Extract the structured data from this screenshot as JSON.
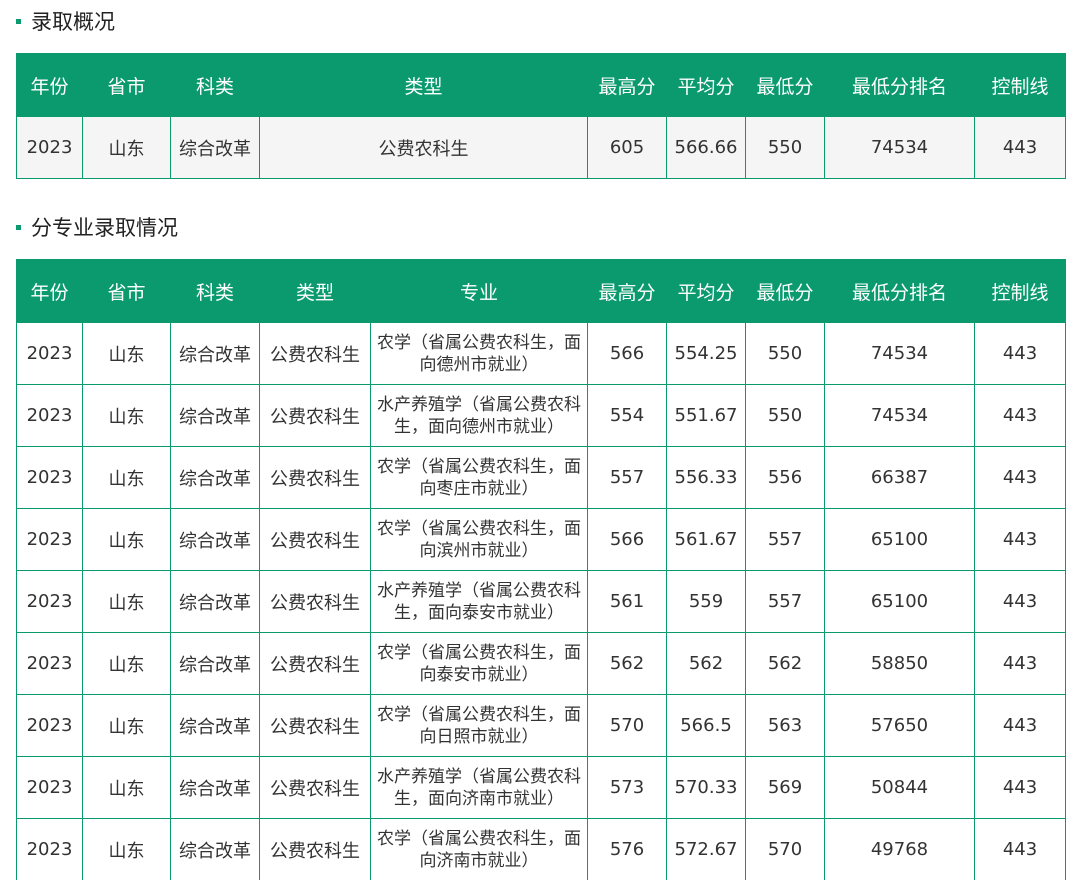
{
  "section1": {
    "title": "录取概况"
  },
  "section2": {
    "title": "分专业录取情况"
  },
  "overview_table": {
    "headers": [
      "年份",
      "省市",
      "科类",
      "类型",
      "最高分",
      "平均分",
      "最低分",
      "最低分排名",
      "控制线"
    ],
    "rows": [
      [
        "2023",
        "山东",
        "综合改革",
        "公费农科生",
        "605",
        "566.66",
        "550",
        "74534",
        "443"
      ]
    ]
  },
  "major_table": {
    "headers": [
      "年份",
      "省市",
      "科类",
      "类型",
      "专业",
      "最高分",
      "平均分",
      "最低分",
      "最低分排名",
      "控制线"
    ],
    "rows": [
      [
        "2023",
        "山东",
        "综合改革",
        "公费农科生",
        "农学（省属公费农科生，面向德州市就业）",
        "566",
        "554.25",
        "550",
        "74534",
        "443"
      ],
      [
        "2023",
        "山东",
        "综合改革",
        "公费农科生",
        "水产养殖学（省属公费农科生，面向德州市就业）",
        "554",
        "551.67",
        "550",
        "74534",
        "443"
      ],
      [
        "2023",
        "山东",
        "综合改革",
        "公费农科生",
        "农学（省属公费农科生，面向枣庄市就业）",
        "557",
        "556.33",
        "556",
        "66387",
        "443"
      ],
      [
        "2023",
        "山东",
        "综合改革",
        "公费农科生",
        "农学（省属公费农科生，面向滨州市就业）",
        "566",
        "561.67",
        "557",
        "65100",
        "443"
      ],
      [
        "2023",
        "山东",
        "综合改革",
        "公费农科生",
        "水产养殖学（省属公费农科生，面向泰安市就业）",
        "561",
        "559",
        "557",
        "65100",
        "443"
      ],
      [
        "2023",
        "山东",
        "综合改革",
        "公费农科生",
        "农学（省属公费农科生，面向泰安市就业）",
        "562",
        "562",
        "562",
        "58850",
        "443"
      ],
      [
        "2023",
        "山东",
        "综合改革",
        "公费农科生",
        "农学（省属公费农科生，面向日照市就业）",
        "570",
        "566.5",
        "563",
        "57650",
        "443"
      ],
      [
        "2023",
        "山东",
        "综合改革",
        "公费农科生",
        "水产养殖学（省属公费农科生，面向济南市就业）",
        "573",
        "570.33",
        "569",
        "50844",
        "443"
      ],
      [
        "2023",
        "山东",
        "综合改革",
        "公费农科生",
        "农学（省属公费农科生，面向济南市就业）",
        "576",
        "572.67",
        "570",
        "49768",
        "443"
      ]
    ]
  }
}
